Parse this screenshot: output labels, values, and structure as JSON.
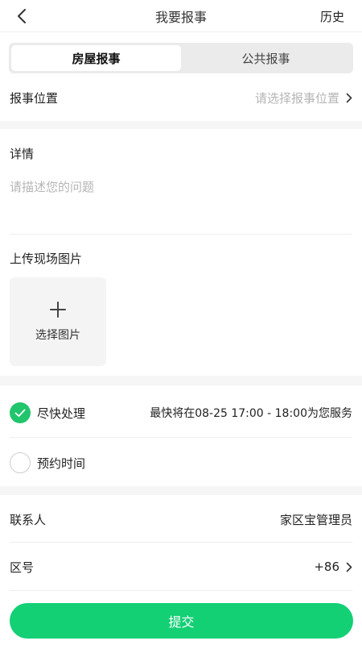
{
  "header": {
    "title": "我要报事",
    "history_label": "历史"
  },
  "tabs": [
    {
      "label": "房屋报事",
      "active": true
    },
    {
      "label": "公共报事",
      "active": false
    }
  ],
  "location": {
    "label": "报事位置",
    "placeholder": "请选择报事位置"
  },
  "details": {
    "label": "详情",
    "placeholder": "请描述您的问题"
  },
  "upload": {
    "label": "上传现场图片",
    "button_label": "选择图片"
  },
  "service_time": {
    "asap_label": "尽快处理",
    "asap_selected": true,
    "asap_info": "最快将在08-25 17:00 - 18:00为您服务",
    "appointment_label": "预约时间",
    "appointment_selected": false
  },
  "contact": {
    "label": "联系人",
    "value": "家区宝管理员"
  },
  "area_code": {
    "label": "区号",
    "value": "+86"
  },
  "submit_label": "提交",
  "colors": {
    "accent": "#13d075",
    "check": "#21c56c",
    "placeholder": "#b5b5b5"
  }
}
